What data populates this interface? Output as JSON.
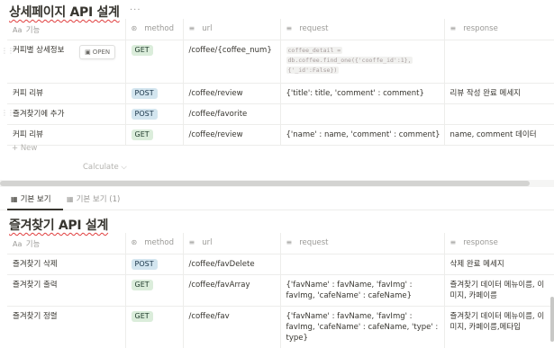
{
  "db1": {
    "title": "상세페이지 API 설계",
    "more": "···",
    "headers": {
      "feature": "기능",
      "feature_icon": "Aa",
      "method": "method",
      "url": "url",
      "request": "request",
      "response": "response"
    },
    "rows": [
      {
        "feature": "커피별 상세정보",
        "open": "OPEN",
        "method": "GET",
        "url": "/coffee/{coffee_num}",
        "request_code": [
          "coffee_detail =",
          "db.coffee.find_one({'cooffe_id':1},",
          "{'_id':False})"
        ],
        "response": ""
      },
      {
        "feature": "커피 리뷰",
        "method": "POST",
        "url": "/coffee/review",
        "request": "{'title': title, 'comment' : comment}",
        "response": "리뷰 작성 완료 메세지"
      },
      {
        "feature": "즐겨찾기에 추가",
        "method": "POST",
        "url": "/coffee/favorite",
        "request": "",
        "response": ""
      },
      {
        "feature": "커피 리뷰",
        "method": "GET",
        "url": "/coffee/review",
        "request": "{'name' : name, 'comment' : comment}",
        "response": "name, comment 데이터"
      }
    ],
    "new_label": "+ New",
    "calculate_label": "Calculate ⌵"
  },
  "tabs": [
    {
      "label": "기본 보기",
      "active": true
    },
    {
      "label": "기본 보기 (1)",
      "active": false
    }
  ],
  "db2": {
    "title": "즐겨찾기 API 설계",
    "headers": {
      "feature": "기능",
      "feature_icon": "Aa",
      "method": "method",
      "url": "url",
      "request": "request",
      "response": "response"
    },
    "rows": [
      {
        "feature": "즐겨찾기 삭제",
        "method": "POST",
        "url": "/coffee/favDelete",
        "request": "",
        "response": "삭제 완료 메세지"
      },
      {
        "feature": "즐겨찾기 출력",
        "method": "GET",
        "url": "/coffee/favArray",
        "request": "{'favName' : favName, 'favImg' : favImg, 'cafeName' : cafeName}",
        "response": "즐겨찾기 데이터 메뉴이름, 이미지, 카페이름"
      },
      {
        "feature": "즐겨찾기 정렬",
        "method": "GET",
        "url": "/coffee/fav",
        "request": "{'favName' : favName, 'favImg' : favImg, 'cafeName' : cafeName, 'type' : type}",
        "response": "즐겨찾기 데이터 메뉴이름, 이미지, 카페이름,메타입"
      }
    ]
  },
  "colors": {
    "get_bg": "#dbeddb",
    "post_bg": "#d3e5ef",
    "text": "#37352f",
    "muted": "#9b9a97",
    "squiggle": "#e03e3e"
  },
  "icons": {
    "method": "status-icon",
    "url": "list-icon",
    "request": "text-icon",
    "response": "text-icon",
    "tab": "table-icon"
  }
}
